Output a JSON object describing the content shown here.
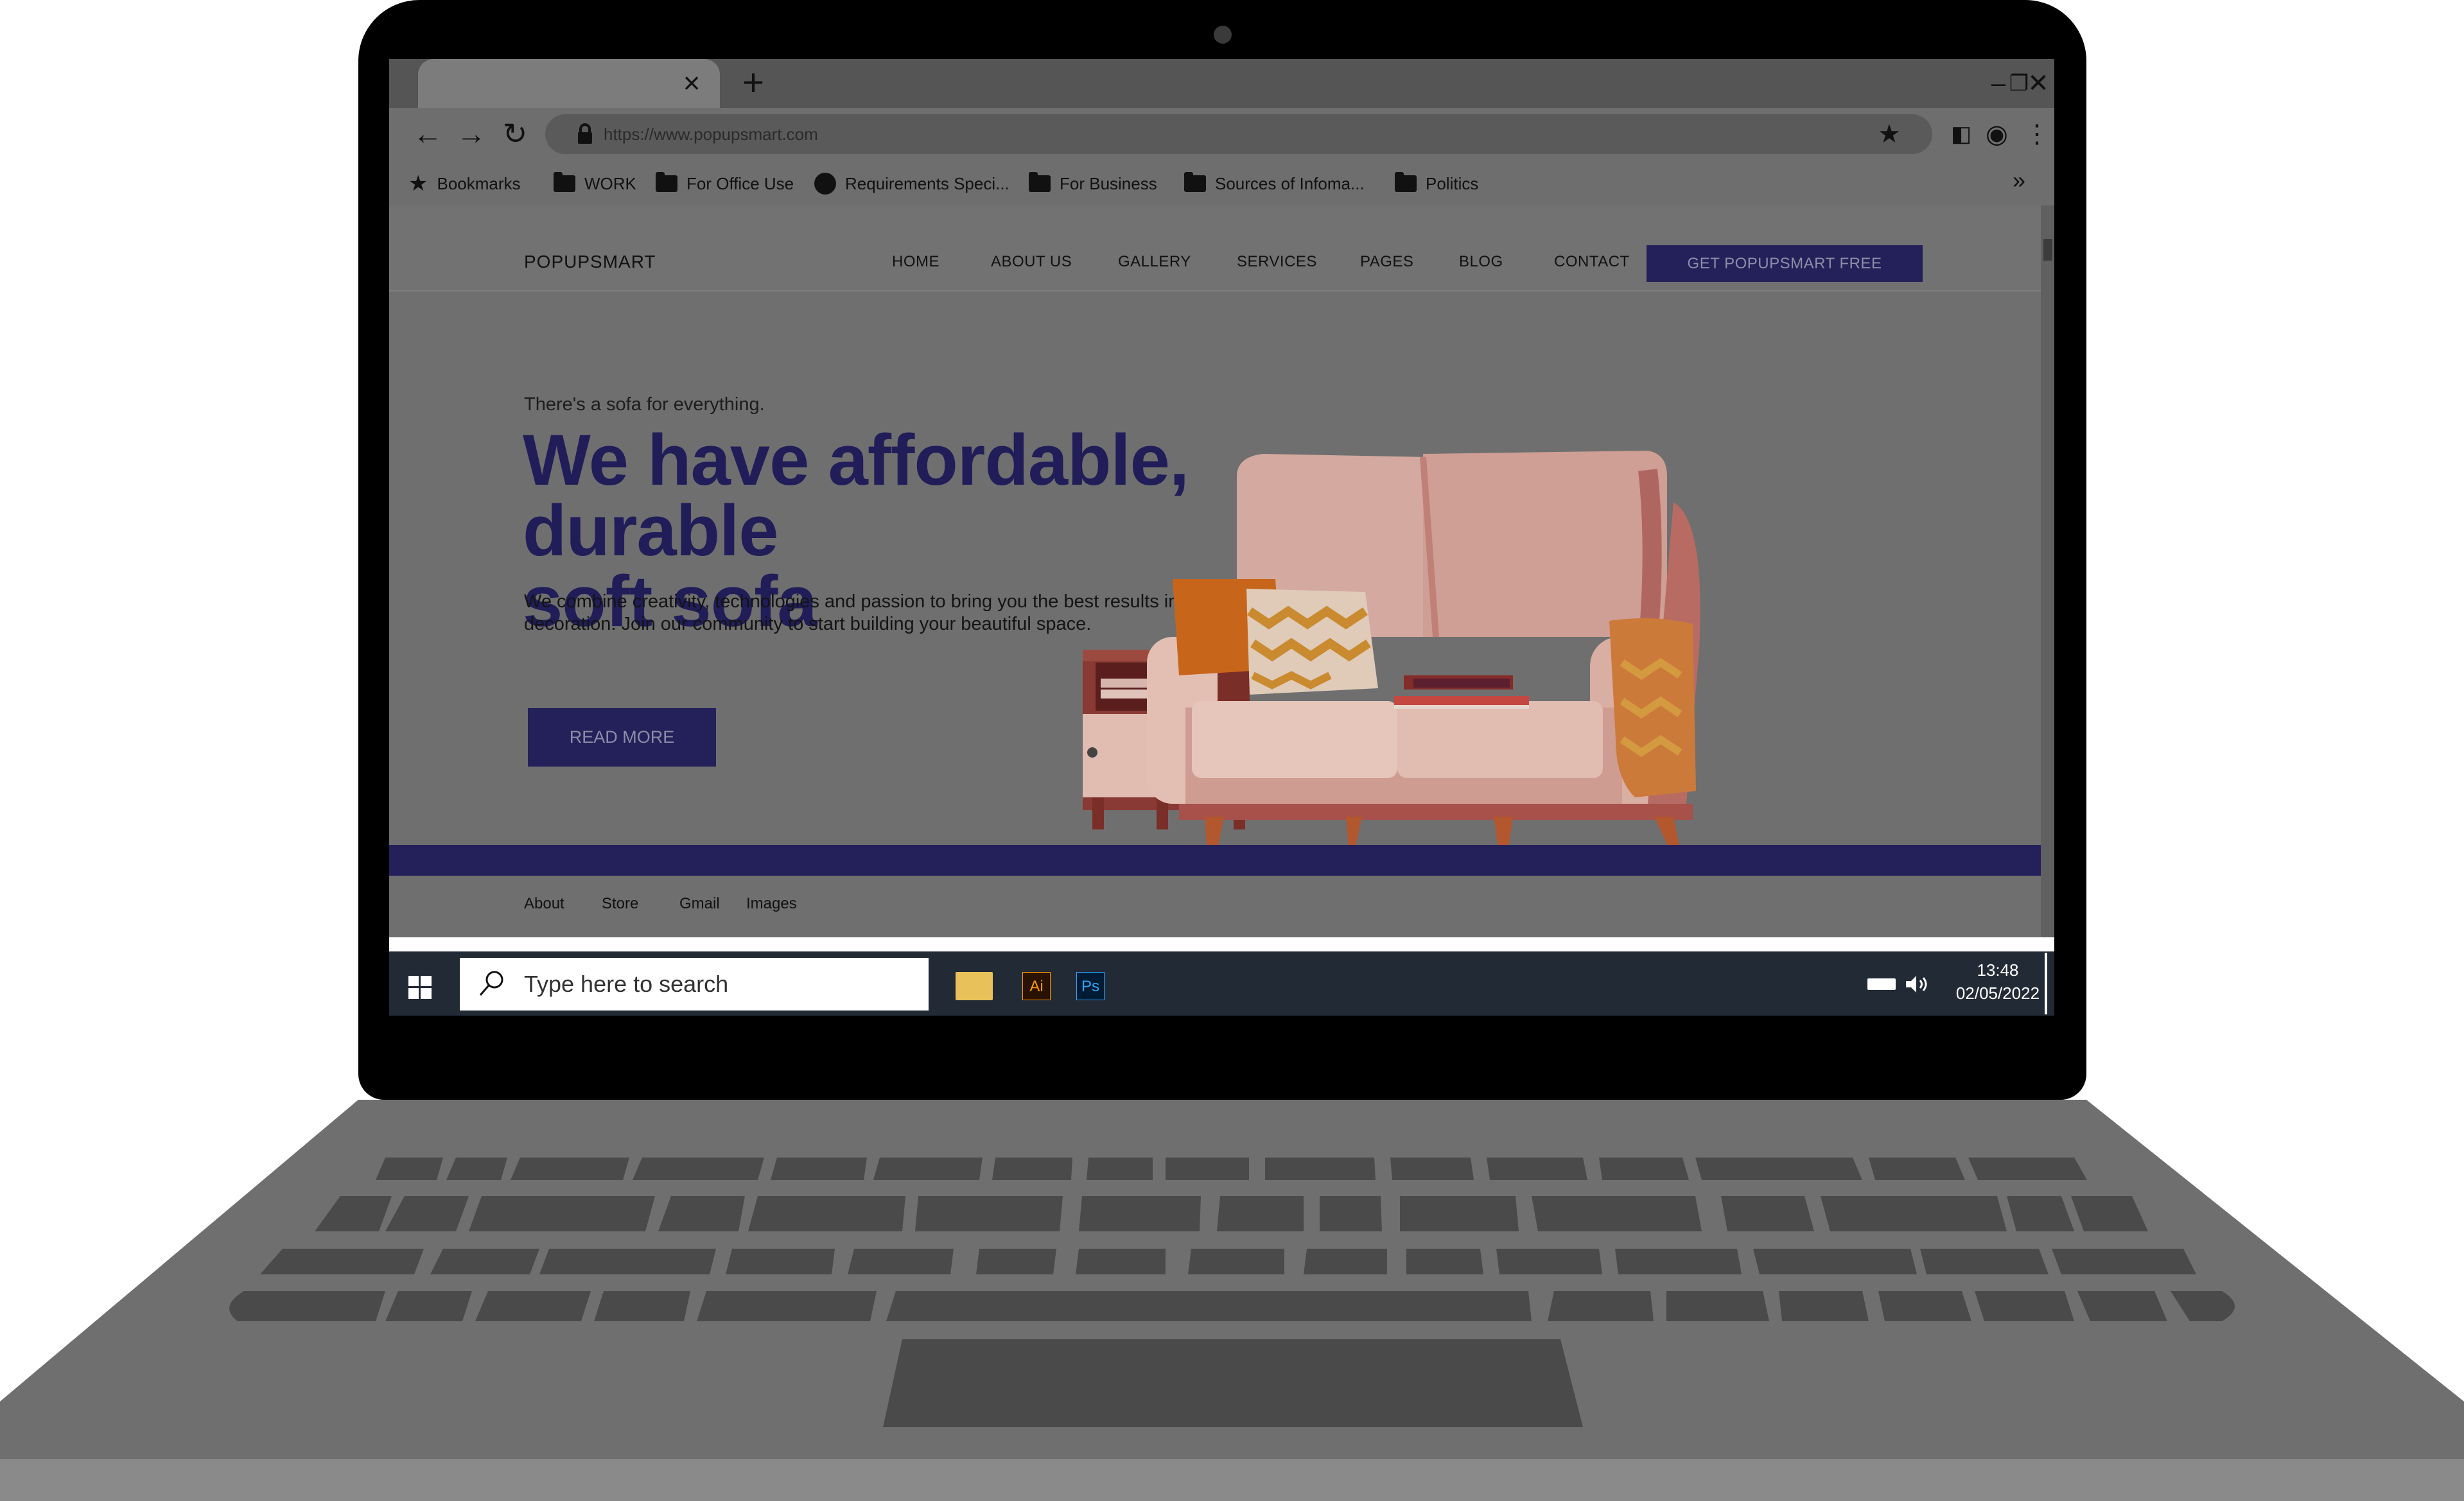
{
  "browser": {
    "url": "https://www.popupsmart.com",
    "bookmarks": [
      "Bookmarks",
      "WORK",
      "For Office Use",
      "Requirements Speci...",
      "For Business",
      "Sources of Infoma...",
      "Politics"
    ]
  },
  "site": {
    "logo": "POPUPSMART",
    "nav": [
      "HOME",
      "ABOUT US",
      "GALLERY",
      "SERVICES",
      "PAGES",
      "BLOG",
      "CONTACT"
    ],
    "cta": "GET POPUPSMART FREE",
    "tagline": "There's a sofa for everything.",
    "headline_line1": "We have affordable, durable",
    "headline_line2": "soft sofa",
    "subtext": "We combine creativity, technologies and passion to bring you the best results in decoration. Join our community to start building your beautiful space.",
    "read_more": "READ MORE",
    "footer_links": [
      "About",
      "Store",
      "Gmail",
      "Images"
    ]
  },
  "taskbar": {
    "search_placeholder": "Type here to search",
    "apps": [
      "Ai",
      "Ps"
    ],
    "time": "13:48",
    "date": "02/05/2022"
  },
  "colors": {
    "brand_navy": "#24205a",
    "headline": "#211d58",
    "taskbar": "#222a36"
  }
}
